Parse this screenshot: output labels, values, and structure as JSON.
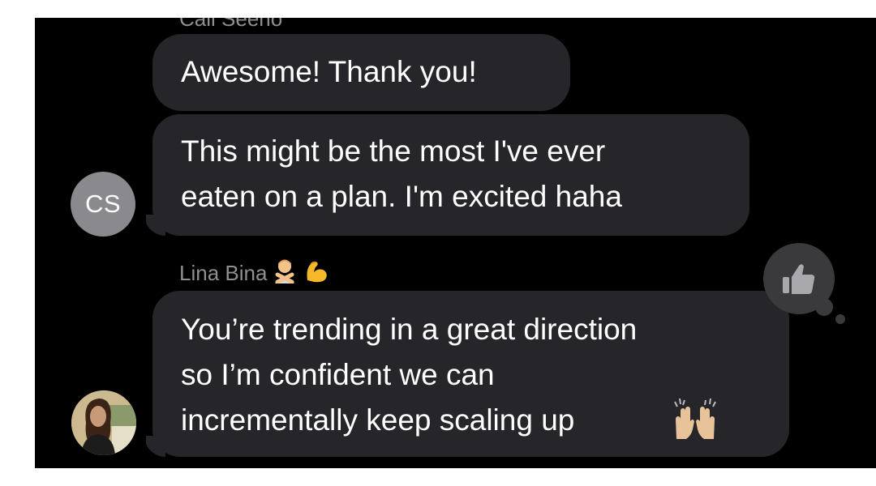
{
  "conversation": {
    "previous_sender": "Cali Seeno",
    "messages": [
      {
        "sender": "CS",
        "text": "Awesome! Thank you!"
      },
      {
        "sender": "CS",
        "text": "This might be the most I've ever\neaten on a plan. I'm excited haha"
      },
      {
        "sender": "Lina Bina",
        "text": "You’re trending in a great direction\nso I’m confident we can\nincrementally keep scaling up"
      }
    ],
    "avatar_cs_initials": "CS",
    "lina_sender_name": "Lina Bina",
    "lina_name_icons": [
      "person-gesturing-no-icon",
      "flexed-biceps-icon"
    ],
    "message_trailing_icon": "raising-hands-icon",
    "reaction_icon": "thumbs-up-icon"
  },
  "colors": {
    "background": "#000000",
    "bubble": "#26252a",
    "text": "#ffffff",
    "secondary_text": "#8e8e93",
    "avatar_gray": "#8a8a8e"
  }
}
